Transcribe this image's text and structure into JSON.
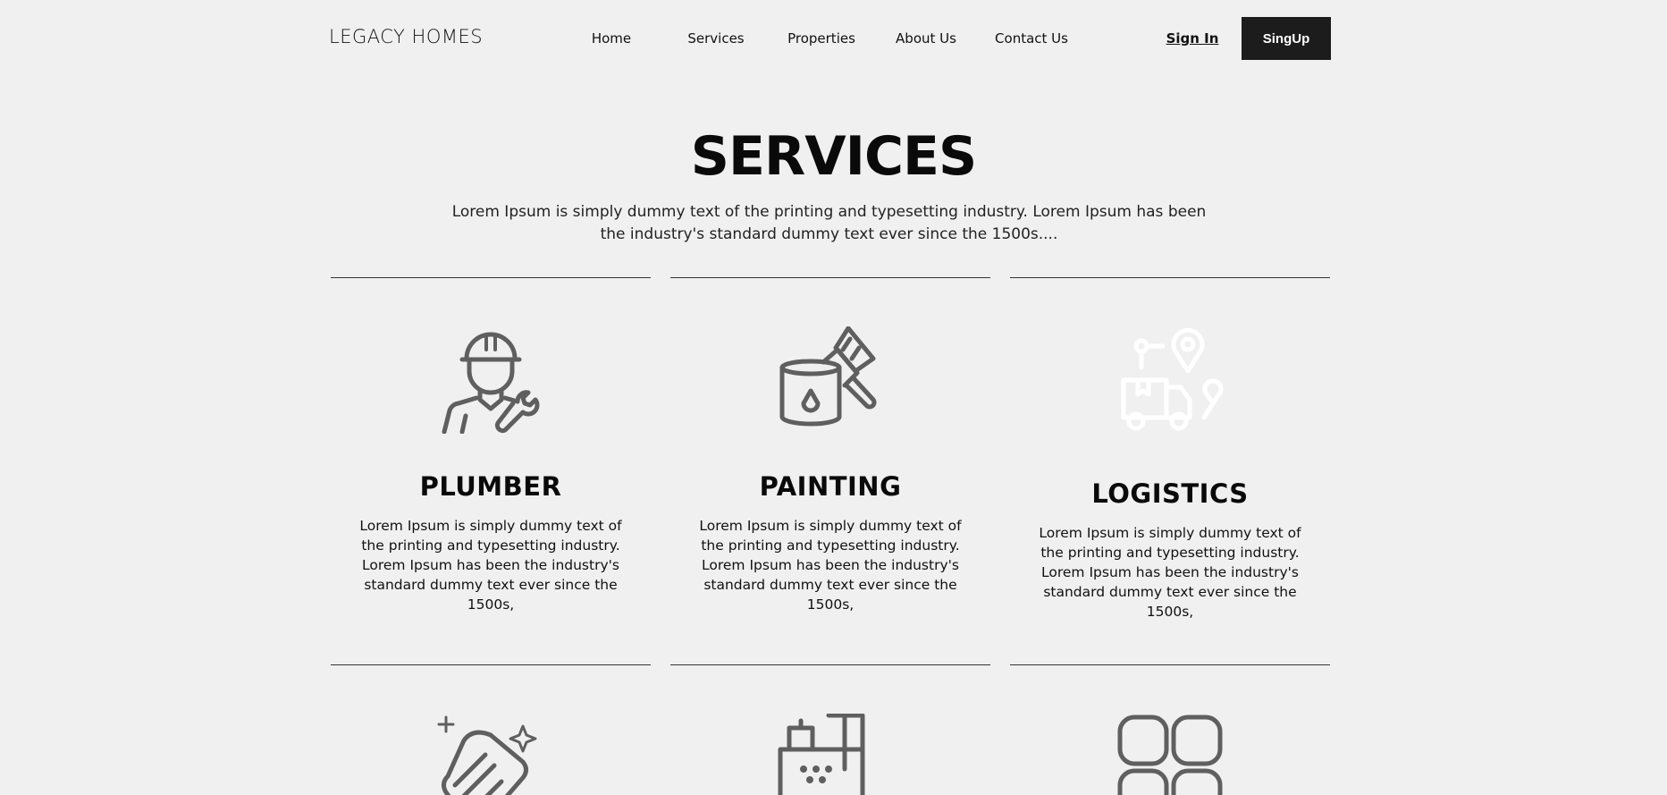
{
  "header": {
    "logo": "LEGACY HOMES",
    "nav": [
      "Home",
      "Services",
      "Properties",
      "About Us",
      "Contact Us"
    ],
    "sign_in": "Sign In",
    "sign_up": "SingUp"
  },
  "hero": {
    "title": "SERVICES",
    "subtitle": "Lorem Ipsum is simply dummy text of the printing and typesetting industry. Lorem Ipsum has been the industry's standard dummy text ever since the 1500s...."
  },
  "services": [
    {
      "title": "PLUMBER",
      "icon": "worker-wrench-icon",
      "text": "Lorem Ipsum is simply dummy text of the printing and typesetting industry. Lorem Ipsum has been the industry's standard dummy text ever since the 1500s,"
    },
    {
      "title": "PAINTING",
      "icon": "paint-bucket-brush-icon",
      "text": "Lorem Ipsum is simply dummy text of the printing and typesetting industry. Lorem Ipsum has been the industry's standard dummy text ever since the 1500s,"
    },
    {
      "title": "LOGISTICS",
      "icon": "delivery-truck-location-icon",
      "text": "Lorem Ipsum is simply dummy text of the printing and typesetting industry. Lorem Ipsum has been the industry's standard dummy text ever since the 1500s,"
    }
  ],
  "second_row_icons": [
    "cleaning-hand-sparkle-icon",
    "floor-machine-icon",
    "grid-apps-icon"
  ],
  "colors": {
    "background": "#f0f0f0",
    "button": "#1c1c1c",
    "icon": "#5f5f5f"
  }
}
